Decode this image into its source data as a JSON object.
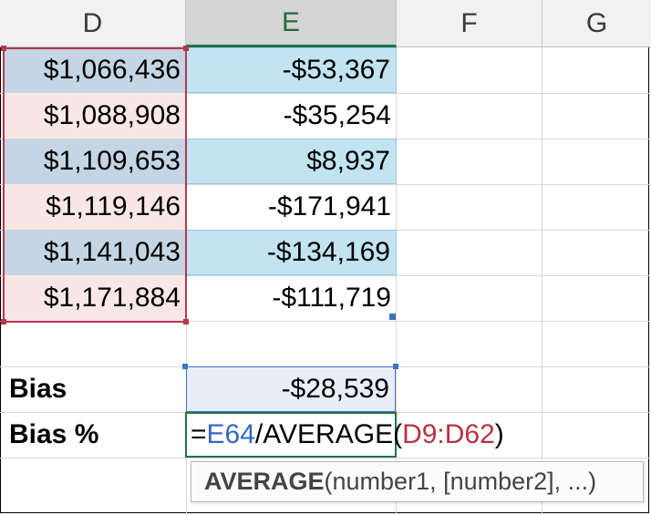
{
  "columns": [
    "D",
    "E",
    "F",
    "G"
  ],
  "rows": [
    {
      "d": "$1,066,436",
      "e": "-$53,367"
    },
    {
      "d": "$1,088,908",
      "e": "-$35,254"
    },
    {
      "d": "$1,109,653",
      "e": "$8,937"
    },
    {
      "d": "$1,119,146",
      "e": "-$171,941"
    },
    {
      "d": "$1,141,043",
      "e": "-$134,169"
    },
    {
      "d": "$1,171,884",
      "e": "-$111,719"
    }
  ],
  "bias": {
    "label": "Bias",
    "value": "-$28,539"
  },
  "bias_pct": {
    "label": "Bias %",
    "formula": {
      "equals": "=",
      "ref1": "E64",
      "mid": "/AVERAGE(",
      "ref2": "D9:D62",
      "end": ")"
    }
  },
  "tooltip": {
    "function_name": "AVERAGE",
    "args": "(number1, [number2], ...)"
  },
  "colors": {
    "d_range_border": "#b5384f",
    "e_ref_border": "#3d72c4",
    "active_cell": "#217346"
  }
}
